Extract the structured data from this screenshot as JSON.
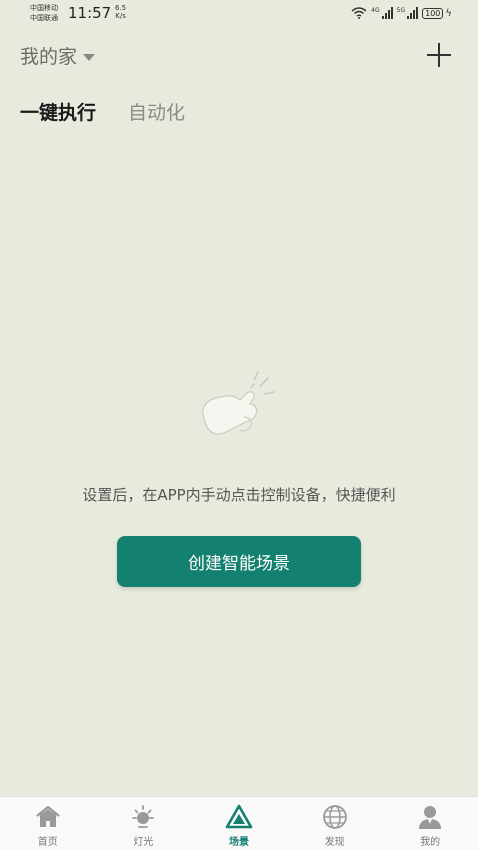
{
  "status_bar": {
    "carrier1": "中国移动",
    "carrier2": "中国联通",
    "time": "11:57",
    "speed_value": "6.5",
    "speed_unit": "K/s",
    "sig1_label": "4G",
    "sig2_label": "5G",
    "battery": "100"
  },
  "header": {
    "home_name": "我的家"
  },
  "tabs": [
    {
      "label": "一键执行",
      "active": true
    },
    {
      "label": "自动化",
      "active": false
    }
  ],
  "empty_state": {
    "illustration": "tap-hand-icon",
    "message": "设置后，在APP内手动点击控制设备，快捷便利",
    "button_label": "创建智能场景"
  },
  "nav": {
    "accent_color": "#14806f",
    "items": [
      {
        "label": "首页",
        "icon": "home-icon"
      },
      {
        "label": "灯光",
        "icon": "light-icon"
      },
      {
        "label": "场景",
        "icon": "scene-icon",
        "active": true
      },
      {
        "label": "发现",
        "icon": "globe-icon"
      },
      {
        "label": "我的",
        "icon": "user-icon"
      }
    ]
  }
}
